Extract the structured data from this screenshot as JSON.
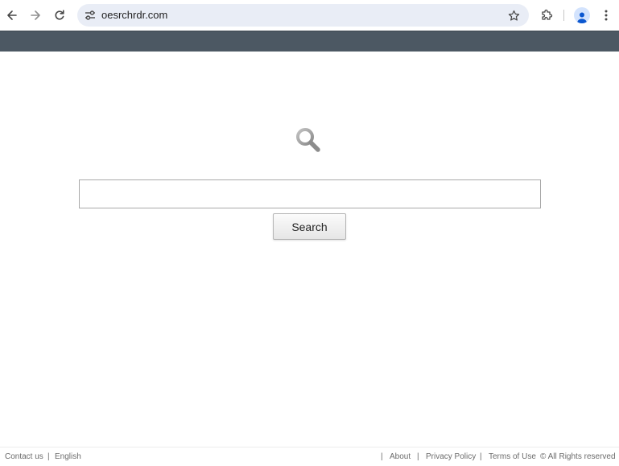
{
  "browser": {
    "url": "oesrchrdr.com",
    "icons": {
      "back": "arrow-left-icon",
      "forward": "arrow-right-icon",
      "reload": "reload-icon",
      "site_info": "tune-icon",
      "bookmark": "star-icon",
      "extensions": "puzzle-icon",
      "profile": "person-icon",
      "menu": "more-vert-icon"
    }
  },
  "page": {
    "band_color": "#4c5863",
    "search_field": {
      "value": "",
      "placeholder": ""
    },
    "search_button_label": "Search"
  },
  "footer": {
    "contact": "Contact us",
    "separator": "|",
    "language": "English",
    "about": "About",
    "privacy": "Privacy Policy",
    "terms": "Terms of Use",
    "rights": "© All Rights reserved"
  }
}
